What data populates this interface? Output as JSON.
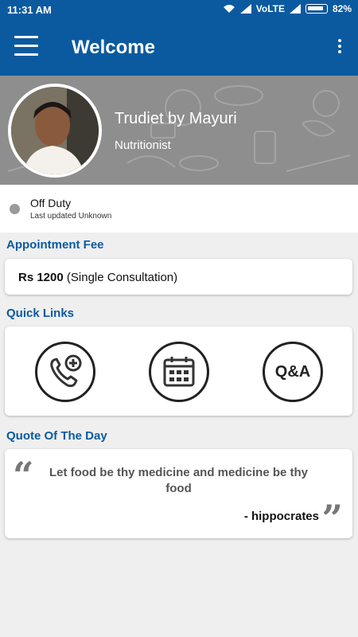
{
  "status_bar": {
    "time": "11:31 AM",
    "network": "VoLTE",
    "battery": "82%",
    "icons": [
      "wifi-icon",
      "signal-icon",
      "signal-icon",
      "battery-icon"
    ]
  },
  "app_bar": {
    "title": "Welcome",
    "menu_icon": "hamburger-menu-icon",
    "overflow_icon": "more-vertical-icon"
  },
  "profile": {
    "name": "Trudiet by Mayuri",
    "role": "Nutritionist"
  },
  "duty": {
    "status": "Off Duty",
    "last_updated": "Last updated Unknown"
  },
  "appointment_fee": {
    "title": "Appointment Fee",
    "amount": "Rs 1200",
    "description": "(Single Consultation)"
  },
  "quick_links": {
    "title": "Quick Links",
    "items": [
      {
        "icon": "phone-add-icon"
      },
      {
        "icon": "calendar-icon"
      },
      {
        "label": "Q&A",
        "icon": "qa-icon"
      }
    ]
  },
  "quote": {
    "title": "Quote Of The Day",
    "text": "Let food be thy medicine and medicine be thy food",
    "author": "- hippocrates"
  },
  "colors": {
    "primary": "#0b5aa0",
    "background": "#efefef",
    "off_duty_dot": "#9a9a9a"
  }
}
